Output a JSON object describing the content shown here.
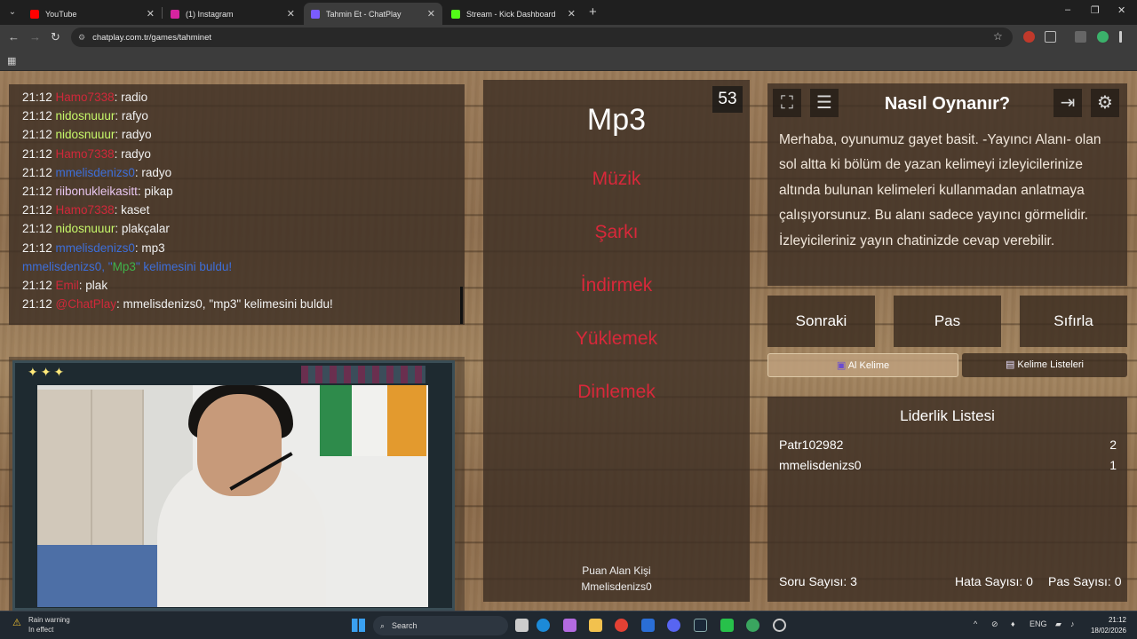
{
  "browser": {
    "tabs": [
      {
        "title": "YouTube",
        "color": "#ff0000",
        "active": false
      },
      {
        "title": "(1) Instagram",
        "color": "#d6249f",
        "active": false
      },
      {
        "title": "Tahmin Et - ChatPlay",
        "color": "#7a5cff",
        "active": true
      },
      {
        "title": "Stream - Kick Dashboard",
        "color": "#53fc18",
        "active": false
      }
    ],
    "url": "chatplay.com.tr/games/tahminet",
    "new_tab": "+",
    "back_icon": "←",
    "forward_icon": "→",
    "reload_icon": "↻",
    "site_icon": "⚙",
    "star_icon": "☆",
    "minimize_icon": "–",
    "restore_icon": "❐",
    "close_icon": "✕",
    "apps_icon": "▦",
    "tab_menu_icon": "⌄"
  },
  "chat": {
    "messages": [
      {
        "time": "21:12",
        "user": "Hamo7338",
        "user_color": "#d0283a",
        "text": ": radio"
      },
      {
        "time": "21:12",
        "user": "nidosnuuur",
        "user_color": "#c6f76a",
        "text": ": rafyo"
      },
      {
        "time": "21:12",
        "user": "nidosnuuur",
        "user_color": "#c6f76a",
        "text": ": radyo"
      },
      {
        "time": "21:12",
        "user": "Hamo7338",
        "user_color": "#d0283a",
        "text": ": radyo"
      },
      {
        "time": "21:12",
        "user": "mmelisdenizs0",
        "user_color": "#3d6ed8",
        "text": ": radyo"
      },
      {
        "time": "21:12",
        "user": "riibonukleikasitt",
        "user_color": "#e8c6f0",
        "text": ": pikap"
      },
      {
        "time": "21:12",
        "user": "Hamo7338",
        "user_color": "#d0283a",
        "text": ": kaset"
      },
      {
        "time": "21:12",
        "user": "nidosnuuur",
        "user_color": "#c6f76a",
        "text": ": plakçalar"
      },
      {
        "time": "21:12",
        "user": "mmelisdenizs0",
        "user_color": "#3d6ed8",
        "text": ": mp3"
      }
    ],
    "found_notice": {
      "user": "mmelisdenizs0",
      "prefix": ", \"",
      "word": "Mp3",
      "suffix": "\" kelimesini buldu!"
    },
    "last_messages": [
      {
        "time": "21:12",
        "user": "Emil",
        "user_color": "#d0283a",
        "text": ": plak"
      },
      {
        "time": "21:12",
        "user": "@ChatPlay",
        "user_color": "#d0283a",
        "text": ": mmelisdenizs0, \"mp3\" kelimesini buldu!"
      }
    ]
  },
  "game": {
    "word": "Mp3",
    "timer": "53",
    "forbidden": [
      "Müzik",
      "Şarkı",
      "İndirmek",
      "Yüklemek",
      "Dinlemek"
    ],
    "scorer_label": "Puan Alan Kişi",
    "scorer_name": "Mmelisdenizs0"
  },
  "howto": {
    "title": "Nasıl Oynanır?",
    "text": "Merhaba, oyunumuz gayet basit. -Yayıncı Alanı- olan sol altta ki bölüm de yazan kelimeyi izleyicilerinize altında bulunan kelimeleri kullanmadan anlatmaya çalışıyorsunuz. Bu alanı sadece yayıncı görmelidir. İzleyicileriniz yayın chatinizde cevap verebilir."
  },
  "controls": {
    "next": "Sonraki",
    "pass": "Pas",
    "reset": "Sıfırla",
    "get_word": "Al Kelime",
    "word_lists": "Kelime Listeleri"
  },
  "leaderboard": {
    "title": "Liderlik Listesi",
    "rows": [
      {
        "name": "Patr102982",
        "score": "2"
      },
      {
        "name": "mmelisdenizs0",
        "score": "1"
      }
    ],
    "question_count": "Soru Sayısı: 3",
    "error_count": "Hata Sayısı: 0",
    "pass_count": "Pas Sayısı: 0"
  },
  "taskbar": {
    "weather_title": "Rain warning",
    "weather_sub": "In effect",
    "search_placeholder": "Search",
    "lang": "ENG",
    "time": "21:12",
    "date": "18/02/2026"
  }
}
